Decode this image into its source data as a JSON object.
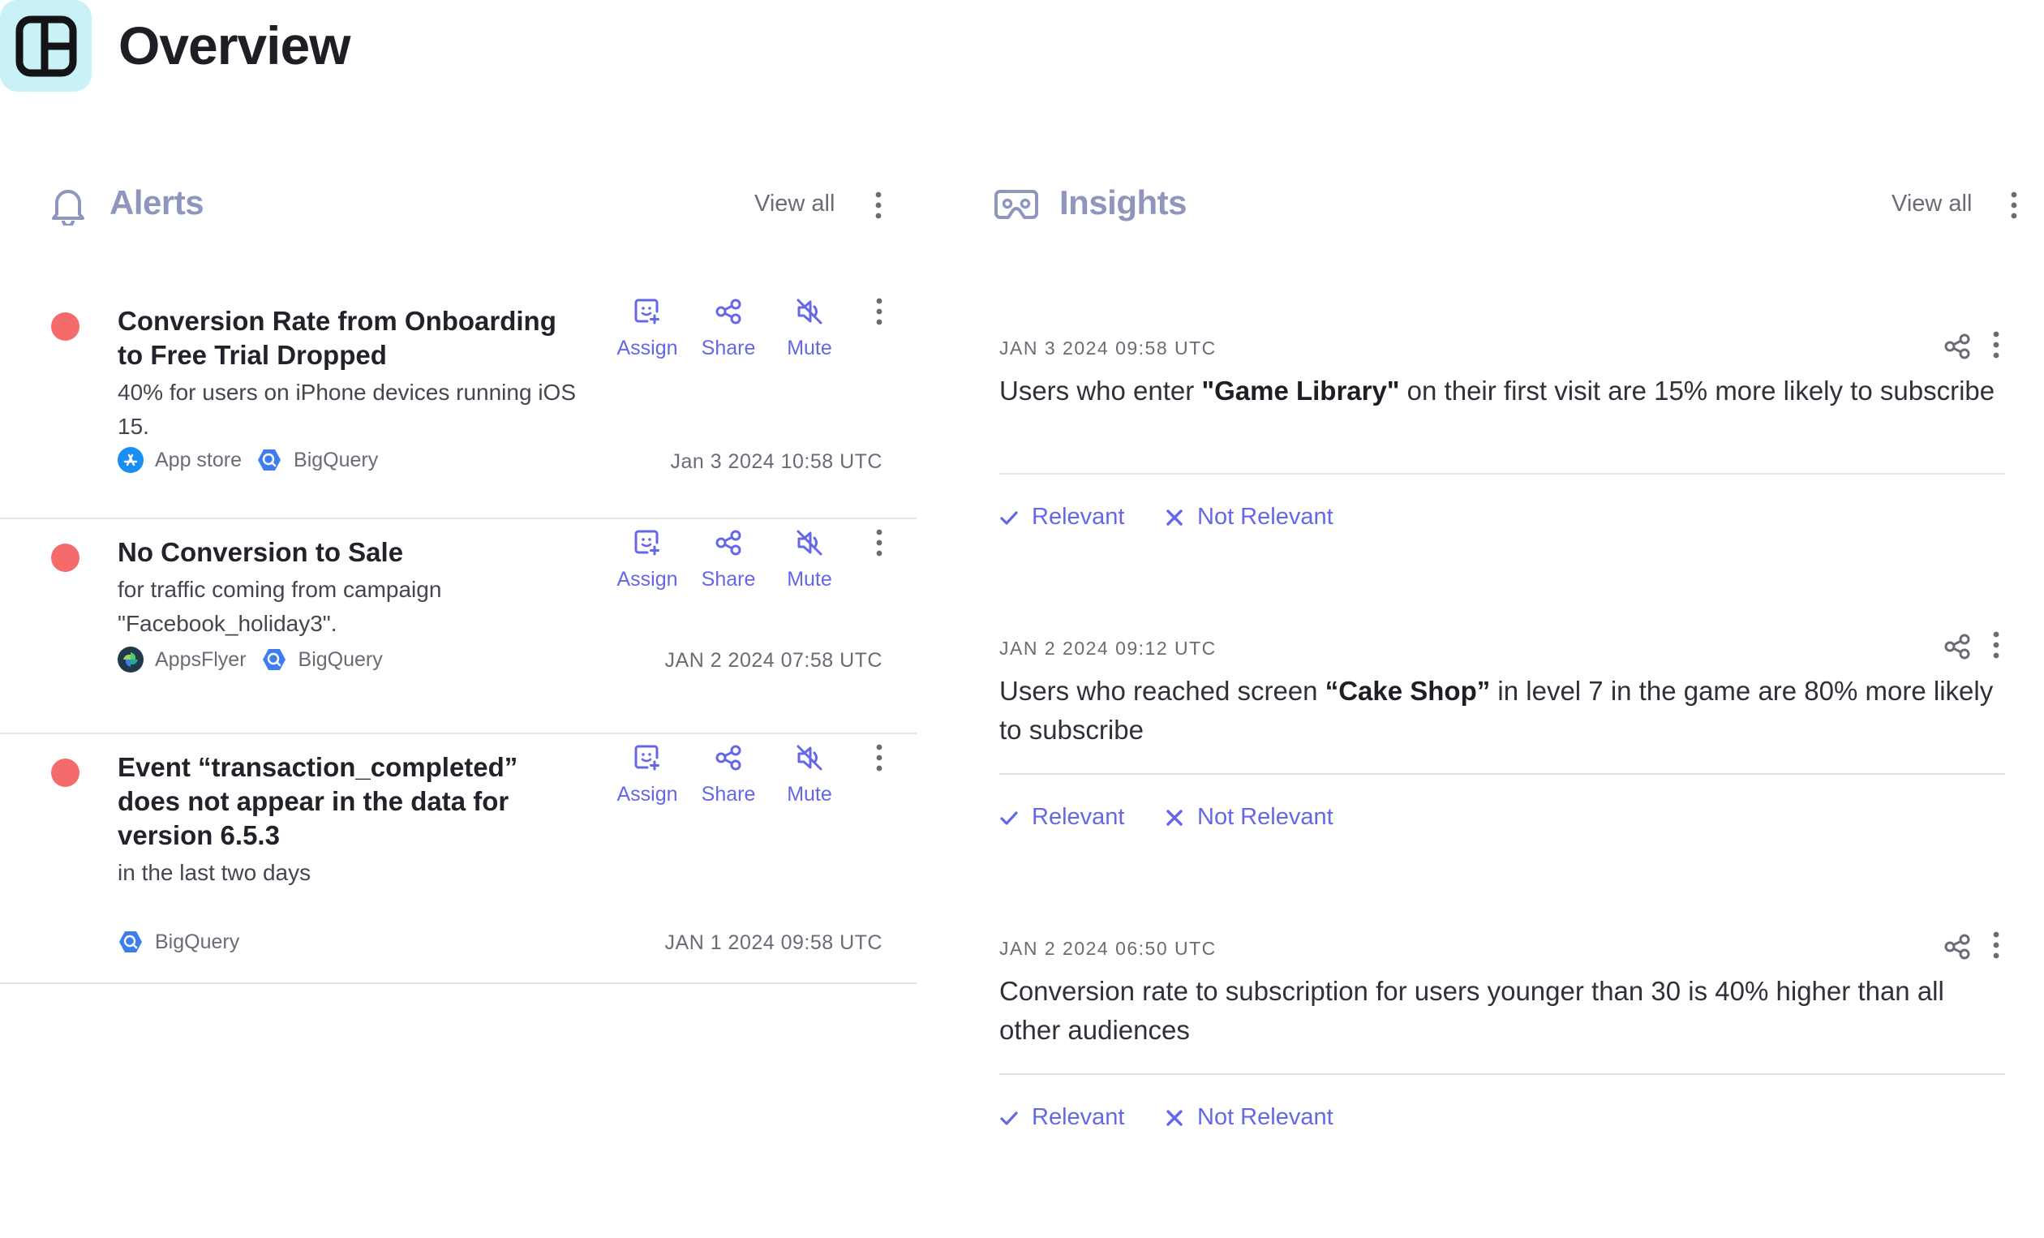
{
  "header": {
    "logo_icon": "layout-panels-icon",
    "title": "Overview"
  },
  "colors": {
    "accent": "#6467e8",
    "alert_status": "#f56b6b",
    "section_title": "#8f96bd",
    "logo_bg": "#c8f1f8"
  },
  "alerts": {
    "icon": "bell-icon",
    "title": "Alerts",
    "view_all": "View all",
    "actions": {
      "assign": "Assign",
      "share": "Share",
      "mute": "Mute"
    },
    "items": [
      {
        "title": "Conversion Rate from Onboarding to Free Trial Dropped",
        "description": "40% for users on iPhone devices running iOS 15.",
        "sources": [
          {
            "label": "App store",
            "icon": "app-store-icon"
          },
          {
            "label": "BigQuery",
            "icon": "bigquery-icon"
          }
        ],
        "timestamp": "Jan 3 2024 10:58 UTC"
      },
      {
        "title": "No Conversion to Sale",
        "description": "for traffic coming from campaign \"Facebook_holiday3\".",
        "sources": [
          {
            "label": "AppsFlyer",
            "icon": "appsflyer-icon"
          },
          {
            "label": "BigQuery",
            "icon": "bigquery-icon"
          }
        ],
        "timestamp": "JAN 2 2024 07:58 UTC"
      },
      {
        "title": "Event “transaction_completed” does not appear in the data for version 6.5.3",
        "description": "in the last two days",
        "sources": [
          {
            "label": "BigQuery",
            "icon": "bigquery-icon"
          }
        ],
        "timestamp": "JAN 1 2024 09:58 UTC"
      }
    ]
  },
  "insights": {
    "icon": "vr-headset-icon",
    "title": "Insights",
    "view_all": "View all",
    "relevant": "Relevant",
    "not_relevant": "Not Relevant",
    "items": [
      {
        "date": "JAN 3 2024 09:58 UTC",
        "text_parts": [
          "Users who enter ",
          "\"Game Library\"",
          " on their first visit are 15% more likely to subscribe"
        ]
      },
      {
        "date": "JAN 2 2024 09:12 UTC",
        "text_parts": [
          "Users who reached screen ",
          "“Cake Shop”",
          " in level 7 in the game are 80% more likely to subscribe"
        ]
      },
      {
        "date": "JAN 2 2024 06:50 UTC",
        "text_parts": [
          "Conversion rate to subscription for users younger than 30 is 40% higher than all other audiences"
        ]
      }
    ]
  }
}
